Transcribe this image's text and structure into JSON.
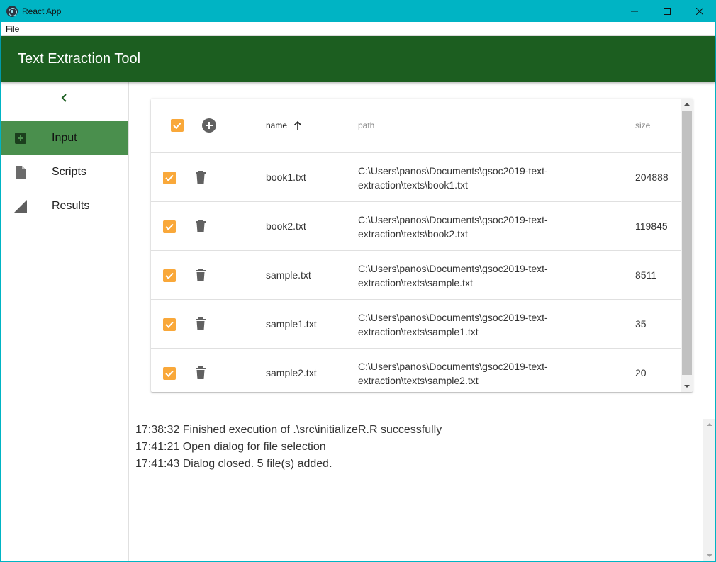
{
  "window": {
    "title": "React App",
    "controls": [
      "minimize-icon",
      "maximize-icon",
      "close-icon"
    ]
  },
  "menu": {
    "items": [
      {
        "label": "File"
      }
    ]
  },
  "appbar": {
    "title": "Text Extraction Tool",
    "color": "#1c5e20"
  },
  "sidebar": {
    "collapse_icon": "chevron-left-icon",
    "items": [
      {
        "label": "Input",
        "icon": "add-box-icon",
        "active": true
      },
      {
        "label": "Scripts",
        "icon": "file-icon",
        "active": false
      },
      {
        "label": "Results",
        "icon": "signal-triangle-icon",
        "active": false
      }
    ]
  },
  "table": {
    "columns": {
      "name": "name",
      "path": "path",
      "size": "size"
    },
    "sort": {
      "column": "name",
      "direction": "ascending",
      "icon": "arrow-up-icon"
    },
    "header_checked": true,
    "rows": [
      {
        "checked": true,
        "name": "book1.txt",
        "path": "C:\\Users\\panos\\Documents\\gsoc2019-text-extraction\\texts\\book1.txt",
        "size": "204888"
      },
      {
        "checked": true,
        "name": "book2.txt",
        "path": "C:\\Users\\panos\\Documents\\gsoc2019-text-extraction\\texts\\book2.txt",
        "size": "119845"
      },
      {
        "checked": true,
        "name": "sample.txt",
        "path": "C:\\Users\\panos\\Documents\\gsoc2019-text-extraction\\texts\\sample.txt",
        "size": "8511"
      },
      {
        "checked": true,
        "name": "sample1.txt",
        "path": "C:\\Users\\panos\\Documents\\gsoc2019-text-extraction\\texts\\sample1.txt",
        "size": "35"
      },
      {
        "checked": true,
        "name": "sample2.txt",
        "path": "C:\\Users\\panos\\Documents\\gsoc2019-text-extraction\\texts\\sample2.txt",
        "size": "20"
      }
    ],
    "checkbox_color": "#f9a83a"
  },
  "log": {
    "lines": [
      "17:38:32 Finished execution of .\\src\\initializeR.R successfully",
      "17:41:21 Open dialog for file selection",
      "17:41:43 Dialog closed. 5 file(s) added."
    ]
  },
  "colors": {
    "titlebar": "#00b4c4",
    "active_nav": "#4a8f4d",
    "accent": "#f9a83a"
  }
}
